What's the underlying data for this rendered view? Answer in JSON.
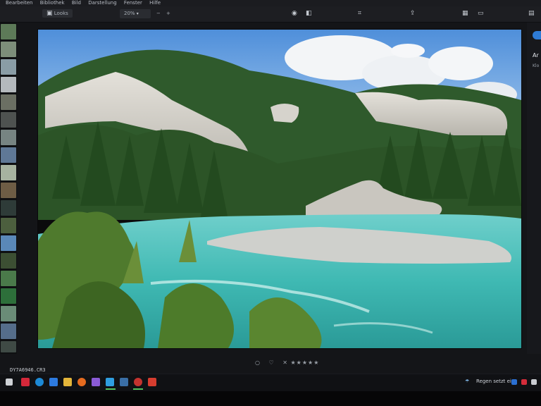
{
  "menubar": {
    "items": [
      "Bearbeiten",
      "Bibliothek",
      "Bild",
      "Darstellung",
      "Fenster",
      "Hilfe"
    ]
  },
  "toolbar": {
    "looks_label": "Looks",
    "zoom_value": "20%",
    "zoom_minus": "−",
    "zoom_plus": "+"
  },
  "right_panel": {
    "title_fragment": "Ar",
    "subtitle_fragment": "Klo"
  },
  "file": {
    "name": "DY7A6946.CR3"
  },
  "rating": {
    "reject_label": "○",
    "like_label": "♡",
    "clear_label": "✕",
    "stars": "★★★★★",
    "stars_count": 0
  },
  "taskbar": {
    "weather_text": "Regen setzt ein",
    "weather_icon": "umbrella-icon"
  },
  "colors": {
    "accent_green": "#56c25f",
    "photo_sky": "#6fa6e2",
    "photo_river": "#4ec7c1"
  }
}
